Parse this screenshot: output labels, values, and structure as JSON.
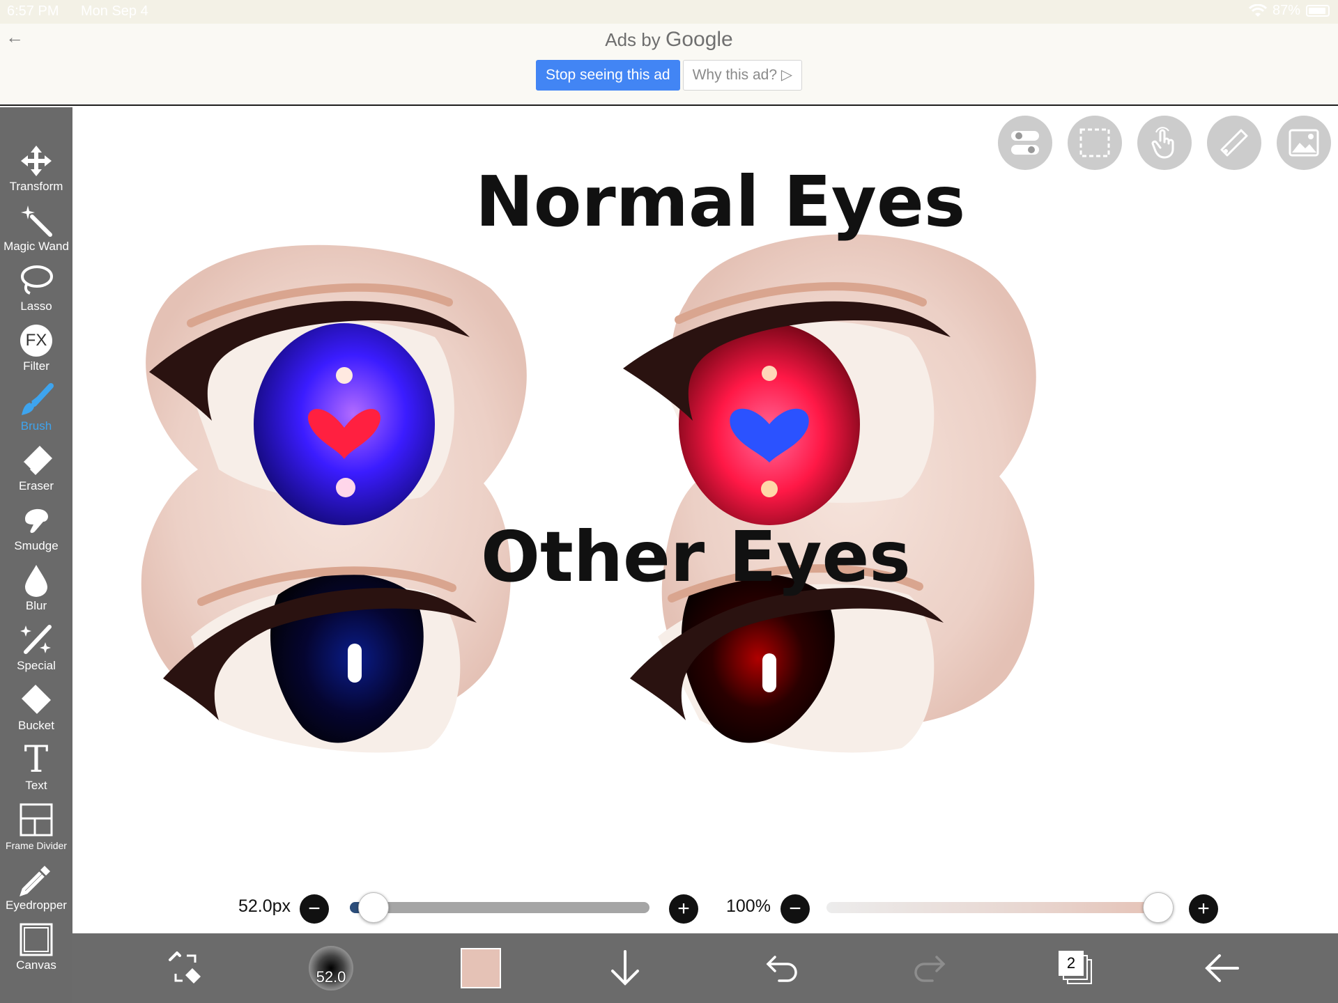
{
  "status_bar": {
    "time": "6:57 PM",
    "date": "Mon Sep 4",
    "battery": "87%"
  },
  "ad": {
    "ads_by": "Ads by",
    "google": "Google",
    "stop_button": "Stop seeing this ad",
    "why_button": "Why this ad?"
  },
  "tools": [
    {
      "label": "Transform",
      "icon": "move-arrows-icon"
    },
    {
      "label": "Magic Wand",
      "icon": "magic-wand-icon"
    },
    {
      "label": "Lasso",
      "icon": "lasso-icon"
    },
    {
      "label": "Filter",
      "icon": "fx-icon",
      "glyph": "FX"
    },
    {
      "label": "Brush",
      "icon": "brush-icon",
      "active": true
    },
    {
      "label": "Eraser",
      "icon": "eraser-icon"
    },
    {
      "label": "Smudge",
      "icon": "smudge-icon"
    },
    {
      "label": "Blur",
      "icon": "droplet-icon"
    },
    {
      "label": "Special",
      "icon": "sparkle-wand-icon"
    },
    {
      "label": "Bucket",
      "icon": "bucket-icon"
    },
    {
      "label": "Text",
      "icon": "text-icon",
      "glyph": "T"
    },
    {
      "label": "Frame Divider",
      "icon": "frame-divider-icon"
    },
    {
      "label": "Eyedropper",
      "icon": "eyedropper-icon"
    },
    {
      "label": "Canvas",
      "icon": "canvas-icon"
    }
  ],
  "canvas": {
    "heading_top": "Normal Eyes",
    "heading_middle": "Other Eyes"
  },
  "brush_size": {
    "value_text": "52.0px",
    "fraction": 0.08
  },
  "opacity": {
    "value_text": "100%",
    "fraction": 1.0
  },
  "bottom_bar": {
    "brush_preview_size": "52.0",
    "layer_count": "2",
    "current_color": "#e5c2b6"
  },
  "colors": {
    "toolbar_bg": "#6a6a6a",
    "active_tool": "#3ea4ee",
    "ad_primary": "#4285f4",
    "skin": "#ecd2c9",
    "blue_iris": "#2a1bff",
    "red_iris": "#ff1d4a"
  }
}
